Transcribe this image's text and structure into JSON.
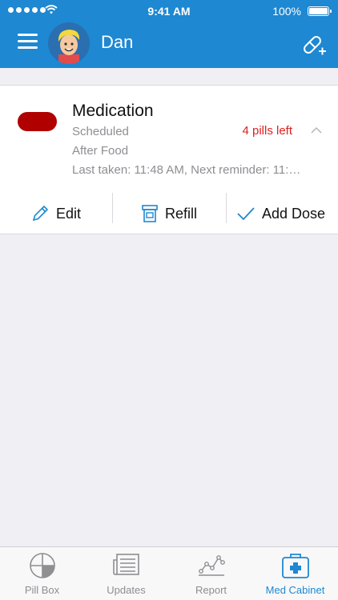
{
  "status_bar": {
    "time": "9:41 AM",
    "battery": "100%"
  },
  "header": {
    "user_name": "Dan",
    "menu_icon": "hamburger-icon",
    "add_icon": "pill-plus-icon",
    "bg_color": "#1e88d2"
  },
  "medication": {
    "name": "Medication",
    "schedule": "Scheduled",
    "pills_left": "4 pills left",
    "instruction": "After Food",
    "last_taken": "Last taken: 11:48 AM, Next reminder: 11:…",
    "pill_color": "#b00000"
  },
  "actions": [
    {
      "label": "Edit",
      "icon": "pencil-icon"
    },
    {
      "label": "Refill",
      "icon": "pill-bottle-icon"
    },
    {
      "label": "Add Dose",
      "icon": "checkmark-icon"
    }
  ],
  "tabs": [
    {
      "label": "Pill Box",
      "icon": "pillbox-icon"
    },
    {
      "label": "Updates",
      "icon": "newspaper-icon"
    },
    {
      "label": "Report",
      "icon": "chart-line-icon"
    },
    {
      "label": "Med Cabinet",
      "icon": "med-cabinet-icon",
      "active": true
    }
  ],
  "colors": {
    "accent": "#1e88d2",
    "alert": "#e02020"
  }
}
